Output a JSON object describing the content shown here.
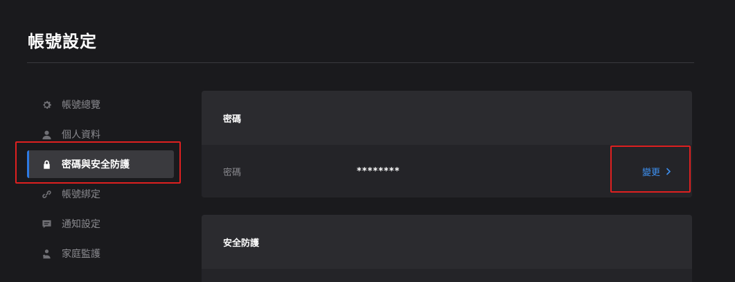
{
  "page": {
    "title": "帳號設定"
  },
  "sidebar": {
    "items": [
      {
        "label": "帳號總覽",
        "icon": "gear-icon"
      },
      {
        "label": "個人資料",
        "icon": "user-icon"
      },
      {
        "label": "密碼與安全防護",
        "icon": "lock-icon",
        "active": true
      },
      {
        "label": "帳號綁定",
        "icon": "link-icon"
      },
      {
        "label": "通知設定",
        "icon": "message-icon"
      },
      {
        "label": "家庭監護",
        "icon": "family-icon"
      }
    ]
  },
  "password_card": {
    "title": "密碼",
    "row_label": "密碼",
    "row_value": "********",
    "change_label": "變更"
  },
  "security_card": {
    "title": "安全防護"
  },
  "colors": {
    "background": "#1a1a1d",
    "card": "#2b2b2f",
    "accent": "#2d7be5",
    "link": "#3d8fef",
    "highlight": "#e02020"
  }
}
